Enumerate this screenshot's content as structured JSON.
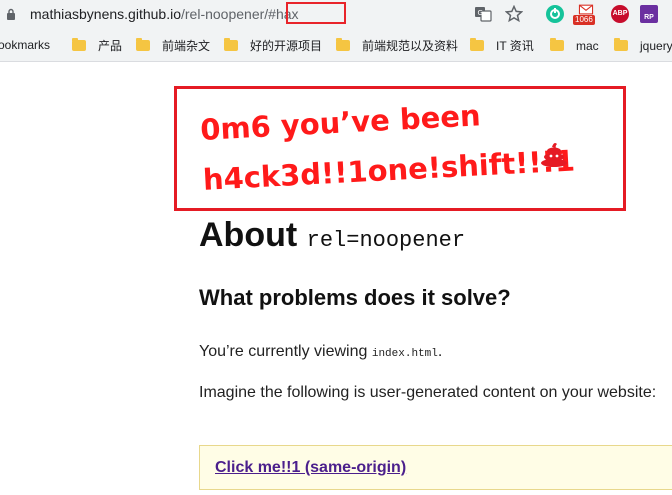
{
  "browser": {
    "url_host": "mathiasbynens.github.io",
    "url_path": "/rel-noopener/",
    "url_hash": "#hax",
    "extensions": {
      "gmail_badge": "1066",
      "abp_label": "ABP",
      "rp_label": "RP"
    }
  },
  "bookmarks": {
    "all_label": "ookmarks",
    "items": [
      {
        "label": "产品"
      },
      {
        "label": "前端杂文"
      },
      {
        "label": "好的开源项目"
      },
      {
        "label": "前端规范以及资料"
      },
      {
        "label": "IT 资讯"
      },
      {
        "label": "mac"
      },
      {
        "label": "jquery"
      }
    ]
  },
  "hack_banner": {
    "line1": "0m6 you’ve been",
    "line2": "h4ck3d!!1one!shift!!!1"
  },
  "page": {
    "title_main": "About",
    "title_code": "rel=noopener",
    "section_heading": "What problems does it solve?",
    "para1_text": "You’re currently viewing",
    "para1_code": "index.html",
    "para1_end": ".",
    "para2": "Imagine the following is user-generated content on your website:",
    "link_text": "Click me!!1 (same-origin)"
  },
  "colors": {
    "hack_red": "#ff1a1a",
    "link_purple": "#4b1f8c",
    "callout_bg": "#fffde6"
  }
}
